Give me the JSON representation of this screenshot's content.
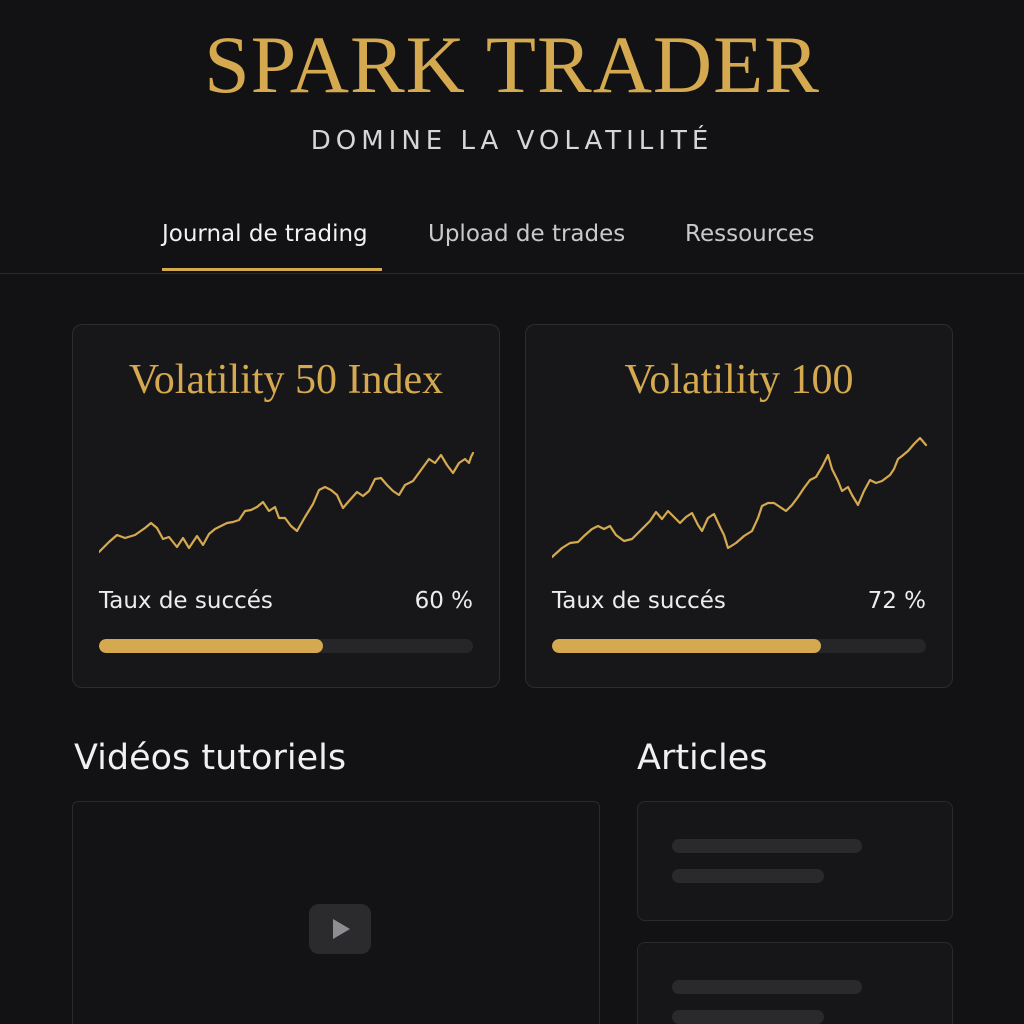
{
  "header": {
    "brand": "SPARK TRADER",
    "tagline": "DOMINE LA VOLATILITÉ"
  },
  "nav": {
    "tabs": [
      {
        "label": "Journal de trading",
        "active": true
      },
      {
        "label": "Upload de trades",
        "active": false
      },
      {
        "label": "Ressources",
        "active": false
      }
    ]
  },
  "cards": [
    {
      "title": "Volatility 50 Index",
      "rate_label": "Taux de succés",
      "rate_value": "60 %",
      "rate_fraction": 0.6
    },
    {
      "title": "Volatility 100",
      "rate_label": "Taux de succés",
      "rate_value": "72 %",
      "rate_fraction": 0.72
    }
  ],
  "sections": {
    "videos_title": "Vidéos tutoriels",
    "articles_title": "Articles"
  },
  "icons": {
    "play": "play-icon"
  },
  "colors": {
    "accent": "#d4a94f",
    "background": "#121214",
    "card": "#17171a"
  }
}
